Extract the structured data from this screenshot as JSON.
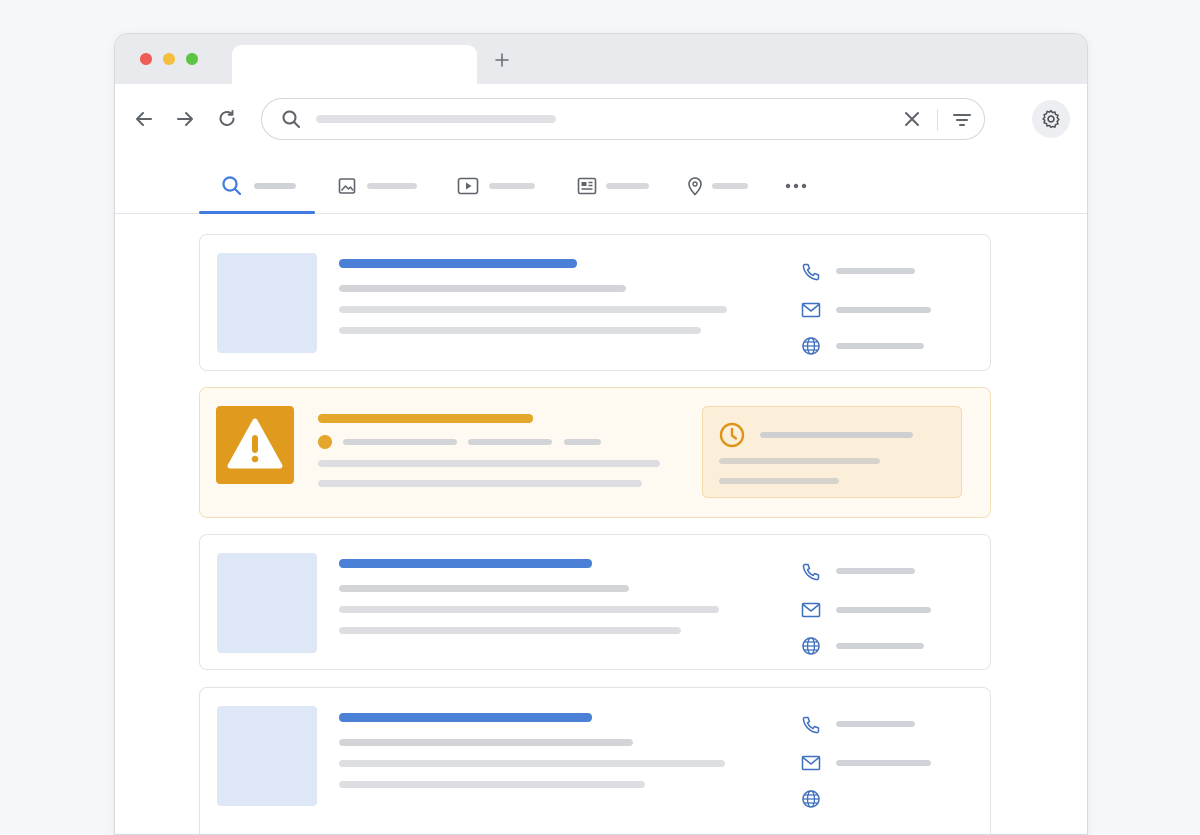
{
  "browser": {
    "traffic_lights": [
      "#ee5c54",
      "#f4be3f",
      "#5ec443"
    ],
    "new_tab_icon": "plus-icon",
    "nav_icons": [
      "back-arrow-icon",
      "forward-arrow-icon",
      "reload-icon"
    ],
    "settings_icon": "gear-icon"
  },
  "search_bar": {
    "search_icon": "search-icon",
    "clear_icon": "close-icon",
    "filter_icon": "filter-icon"
  },
  "search_tabs": [
    {
      "icon": "search-icon",
      "active": true
    },
    {
      "icon": "image-icon",
      "active": false
    },
    {
      "icon": "video-icon",
      "active": false
    },
    {
      "icon": "news-icon",
      "active": false
    },
    {
      "icon": "map-pin-icon",
      "active": false
    },
    {
      "icon": "more-icon",
      "active": false
    }
  ],
  "results": [
    {
      "type": "listing",
      "contacts": [
        "phone-icon",
        "mail-icon",
        "globe-icon"
      ]
    },
    {
      "type": "warning",
      "icon": "warning-icon",
      "hours_icon": "clock-icon"
    },
    {
      "type": "listing",
      "contacts": [
        "phone-icon",
        "mail-icon",
        "globe-icon"
      ]
    },
    {
      "type": "listing",
      "contacts": [
        "phone-icon",
        "mail-icon",
        "globe-icon"
      ]
    }
  ],
  "colors": {
    "accent": "#3f7be0",
    "link_bar": "#4a80d6",
    "warning": "#e09a1e",
    "placeholder": "#d9dbdf"
  }
}
